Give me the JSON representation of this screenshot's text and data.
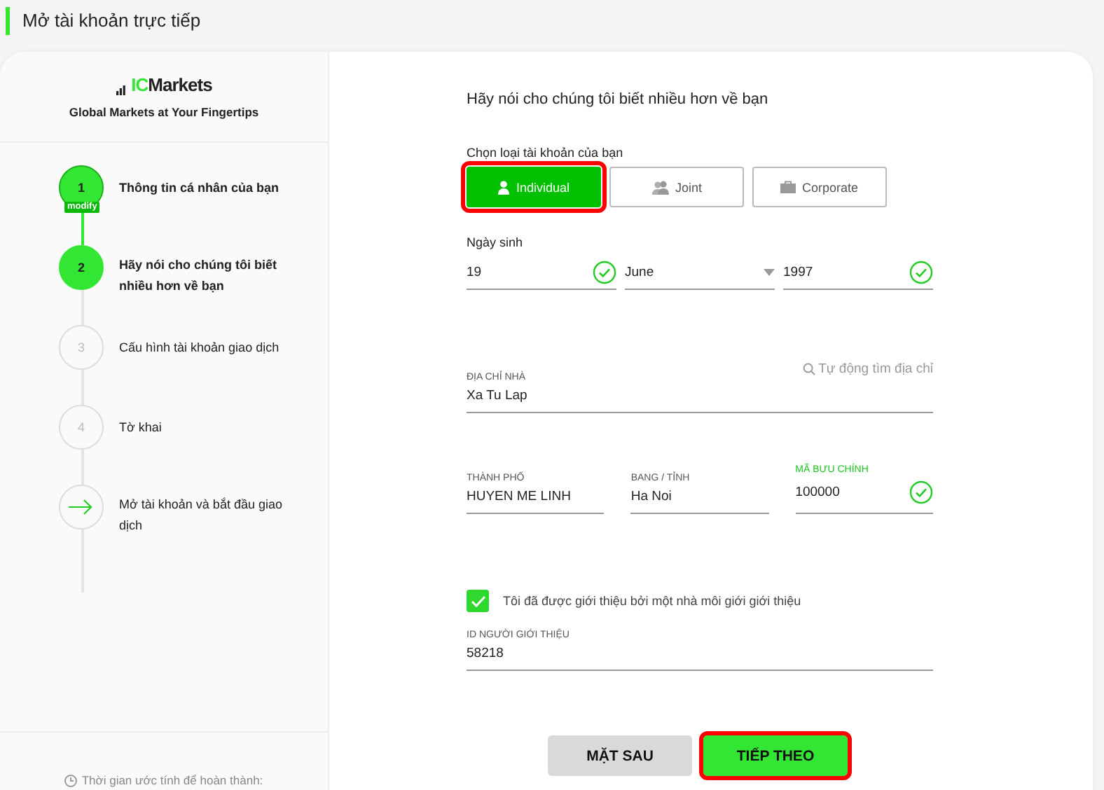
{
  "page_title": "Mở tài khoản trực tiếp",
  "brand": {
    "logo_prefix": "IC",
    "logo_name": "Markets",
    "tagline": "Global Markets at Your Fingertips"
  },
  "steps": [
    {
      "kind": "numbered",
      "marker": "1",
      "label": "Thông tin cá nhân của bạn",
      "completed": true,
      "selected": false,
      "badge": "modify"
    },
    {
      "kind": "numbered",
      "marker": "2",
      "label": "Hãy nói cho chúng tôi biết nhiều hơn về bạn",
      "completed": false,
      "selected": true
    },
    {
      "kind": "numbered",
      "marker": "3",
      "label": "Cấu hình tài khoản giao dịch",
      "completed": false,
      "selected": false
    },
    {
      "kind": "numbered",
      "marker": "4",
      "label": "Tờ khai",
      "completed": false,
      "selected": false
    },
    {
      "kind": "arrow",
      "label": "Mở tài khoản và bắt đầu giao dịch",
      "completed": false,
      "selected": false
    }
  ],
  "estimate": "Thời gian ước tính để hoàn thành:",
  "form": {
    "heading": "Hãy nói cho chúng tôi biết nhiều hơn về bạn",
    "account_type_label": "Chọn loại tài khoản của bạn",
    "account_types": [
      {
        "kind": "individual",
        "label": "Individual",
        "selected": true,
        "highlighted": true
      },
      {
        "kind": "joint",
        "label": "Joint",
        "selected": false,
        "highlighted": false
      },
      {
        "kind": "corporate",
        "label": "Corporate",
        "selected": false,
        "highlighted": false
      }
    ],
    "birth_label": "Ngày sinh",
    "birth_fields": [
      {
        "kind": "text",
        "value": "19",
        "valid": true
      },
      {
        "kind": "select",
        "value": "June",
        "valid": false
      },
      {
        "kind": "text",
        "value": "1997",
        "valid": true
      }
    ],
    "address": {
      "label": "ĐỊA CHỈ NHÀ",
      "value": "Xa Tu Lap",
      "search_link": "Tự động tìm địa chỉ"
    },
    "location_fields": [
      {
        "label": "THÀNH PHỐ",
        "value": "HUYEN ME LINH",
        "valid": false
      },
      {
        "label": "BANG / TỈNH",
        "value": "Ha Noi",
        "valid": false
      },
      {
        "label": "MÃ BƯU CHÍNH",
        "value": "100000",
        "valid": true
      }
    ],
    "referral": {
      "checked": true,
      "label": "Tôi đã được giới thiệu bởi một nhà môi giới giới thiệu"
    },
    "referrer_id": {
      "label": "ID NGƯỜI GIỚI THIỆU",
      "value": "58218"
    },
    "buttons": [
      {
        "kind": "back",
        "label": "MẶT SAU",
        "highlighted": false
      },
      {
        "kind": "next",
        "label": "TIẾP THEO",
        "highlighted": true
      }
    ]
  }
}
